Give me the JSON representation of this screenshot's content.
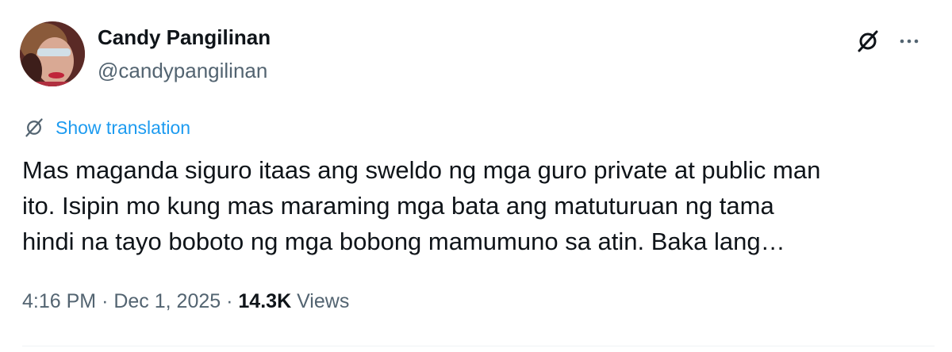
{
  "author": {
    "display_name": "Candy Pangilinan",
    "handle": "@candypangilinan",
    "avatar_icon": "profile-photo"
  },
  "actions": {
    "grok_icon": "grok-icon",
    "more_icon": "more-horizontal-icon"
  },
  "translation": {
    "icon": "grok-icon",
    "label": "Show translation"
  },
  "tweet": {
    "lines": [
      "Mas maganda siguro itaas ang sweldo ng mga guro private at public man",
      "ito. Isipin mo kung mas maraming mga bata ang matuturuan ng tama",
      "hindi na tayo boboto ng mga bobong mamumuno sa atin. Baka lang…"
    ]
  },
  "meta": {
    "time": "4:16 PM",
    "separator": "·",
    "date": "Dec 1, 2025",
    "views_count": "14.3K",
    "views_label": "Views"
  },
  "colors": {
    "text": "#0f1419",
    "secondary": "#536471",
    "link": "#1d9bf0",
    "divider": "#eff3f4"
  }
}
